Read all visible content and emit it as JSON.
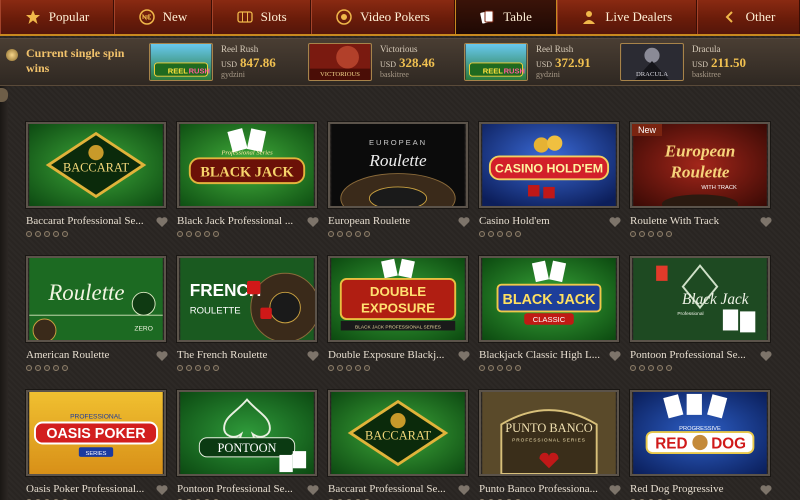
{
  "nav": {
    "tabs": [
      {
        "label": "Popular",
        "icon": "star-icon",
        "active": false
      },
      {
        "label": "New",
        "icon": "new-icon",
        "active": false
      },
      {
        "label": "Slots",
        "icon": "slots-icon",
        "active": false
      },
      {
        "label": "Video Pokers",
        "icon": "poker-chip-icon",
        "active": false
      },
      {
        "label": "Table",
        "icon": "cards-icon",
        "active": true
      },
      {
        "label": "Live Dealers",
        "icon": "dealer-icon",
        "active": false
      },
      {
        "label": "Other",
        "icon": "chevron-left-icon",
        "active": false
      }
    ]
  },
  "wins": {
    "title": "Current single spin wins",
    "items": [
      {
        "game": "Reel Rush",
        "currency": "USD",
        "amount": "847.86",
        "user": "gydzini"
      },
      {
        "game": "Victorious",
        "currency": "USD",
        "amount": "328.46",
        "user": "baskitree"
      },
      {
        "game": "Reel Rush",
        "currency": "USD",
        "amount": "372.91",
        "user": "gydzini"
      },
      {
        "game": "Dracula",
        "currency": "USD",
        "amount": "211.50",
        "user": "baskitree"
      }
    ]
  },
  "games": [
    {
      "name": "Baccarat Professional Se...",
      "badge": ""
    },
    {
      "name": "Black Jack Professional ...",
      "badge": ""
    },
    {
      "name": "European Roulette",
      "badge": ""
    },
    {
      "name": "Casino Hold'em",
      "badge": ""
    },
    {
      "name": "Roulette With Track",
      "badge": "New"
    },
    {
      "name": "American Roulette",
      "badge": ""
    },
    {
      "name": "The French Roulette",
      "badge": ""
    },
    {
      "name": "Double Exposure Blackj...",
      "badge": ""
    },
    {
      "name": "Blackjack Classic High L...",
      "badge": ""
    },
    {
      "name": "Pontoon Professional Se...",
      "badge": ""
    },
    {
      "name": "Oasis Poker Professional...",
      "badge": ""
    },
    {
      "name": "Pontoon Professional Se...",
      "badge": ""
    },
    {
      "name": "Baccarat Professional Se...",
      "badge": ""
    },
    {
      "name": "Punto Banco Professiona...",
      "badge": ""
    },
    {
      "name": "Red Dog Progressive",
      "badge": ""
    }
  ],
  "logos": {
    "win_0": [
      "REEL",
      "RUSH"
    ],
    "win_1": [
      "VICTORIOUS"
    ],
    "win_2": [
      "REEL",
      "RUSH"
    ],
    "win_3": [
      "DRACULA"
    ],
    "g0": [
      "BACCARAT"
    ],
    "g1": [
      "Professional Series",
      "BLACK JACK"
    ],
    "g2": [
      "EUROPEAN",
      "Roulette"
    ],
    "g3": [
      "CASINO HOLD'EM"
    ],
    "g4": [
      "European",
      "Roulette",
      "WITH TRACK"
    ],
    "g5": [
      "Roulette",
      "ZERO"
    ],
    "g6": [
      "FRENCH",
      "ROULETTE"
    ],
    "g7": [
      "DOUBLE",
      "EXPOSURE",
      "BLACK JACK PROFESSIONAL SERIES"
    ],
    "g8": [
      "BLACK JACK",
      "CLASSIC"
    ],
    "g9": [
      "Black Jack",
      "Professional"
    ],
    "g10": [
      "PROFESSIONAL",
      "OASIS POKER",
      "SERIES"
    ],
    "g11": [
      "PONTOON"
    ],
    "g12": [
      "BACCARAT"
    ],
    "g13": [
      "PUNTO BANCO",
      "PROFESSIONAL SERIES"
    ],
    "g14": [
      "PROGRESSIVE",
      "RED",
      "DOG"
    ]
  },
  "colors": {
    "nav_bg": "#7a2410",
    "nav_border": "#c8891f",
    "amount": "#f0c050",
    "page_bg": "#2a2623"
  }
}
